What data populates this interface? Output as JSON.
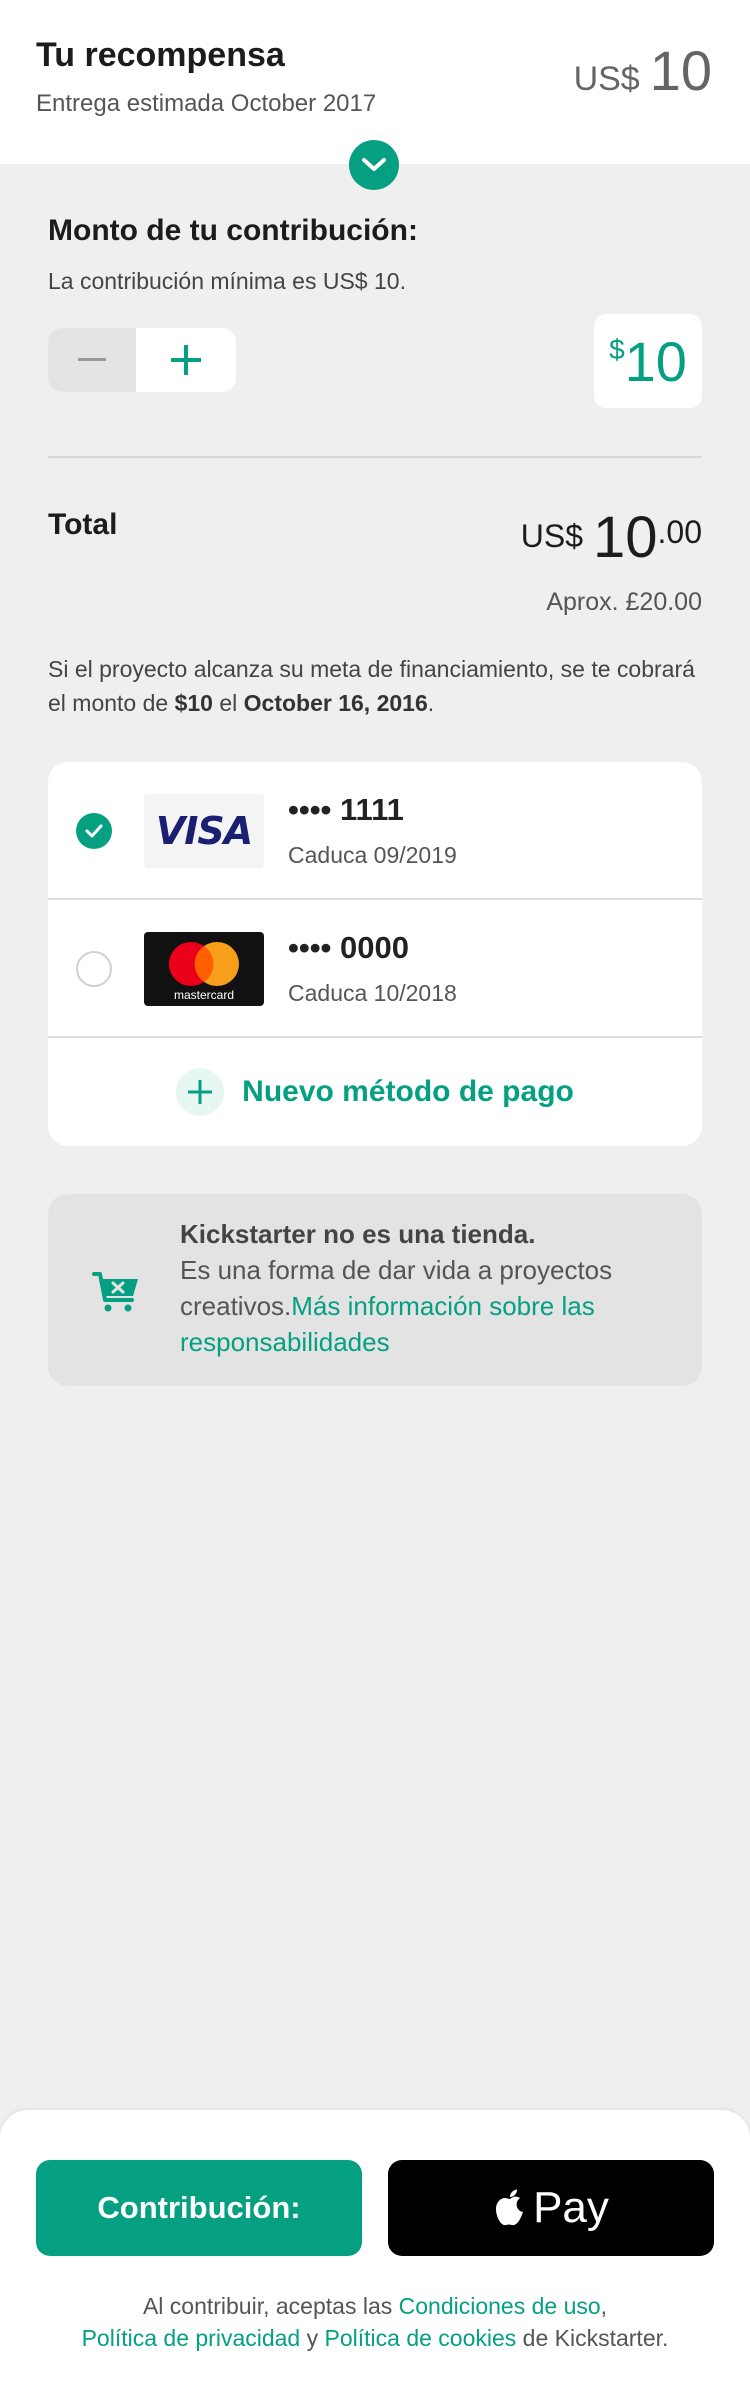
{
  "reward": {
    "title": "Tu recompensa",
    "subtitle": "Entrega estimada October 2017",
    "currency": "US$",
    "amount": "10"
  },
  "pledge": {
    "label": "Monto de tu contribución:",
    "minimum": "La contribución mínima es US$ 10.",
    "symbol": "$",
    "value": "10"
  },
  "total": {
    "label": "Total",
    "currency": "US$",
    "whole": "10",
    "cents": ".00",
    "approx": "Aprox. £20.00"
  },
  "notice": {
    "prefix": "Si el proyecto alcanza su meta de financiamiento, se te cobrará el monto de ",
    "amount": "$10",
    "middle": " el ",
    "date": "October 16, 2016",
    "suffix": "."
  },
  "payment_methods": [
    {
      "brand": "VISA",
      "number": "•••• 1111",
      "expiry": "Caduca 09/2019",
      "selected": true
    },
    {
      "brand": "mastercard",
      "number": "•••• 0000",
      "expiry": "Caduca 10/2018",
      "selected": false
    }
  ],
  "add_payment_label": "Nuevo método de pago",
  "info": {
    "title": "Kickstarter no es una tienda.",
    "body": "Es una forma de dar vida a proyectos creativos.",
    "link": "Más información sobre las responsabilidades"
  },
  "buttons": {
    "pledge": "Contribución:",
    "apple_pay": "Pay"
  },
  "terms": {
    "prefix": "Al contribuir, aceptas las ",
    "terms_link": "Condiciones de uso",
    "comma": ",",
    "privacy_link": "Política de privacidad",
    "and": " y ",
    "cookies_link": "Política de cookies",
    "suffix": " de Kickstarter."
  },
  "colors": {
    "accent": "#05a081",
    "background": "#efefef",
    "visa_blue": "#1a1f71",
    "mc_red": "#eb001b",
    "mc_orange": "#f79e1b"
  }
}
